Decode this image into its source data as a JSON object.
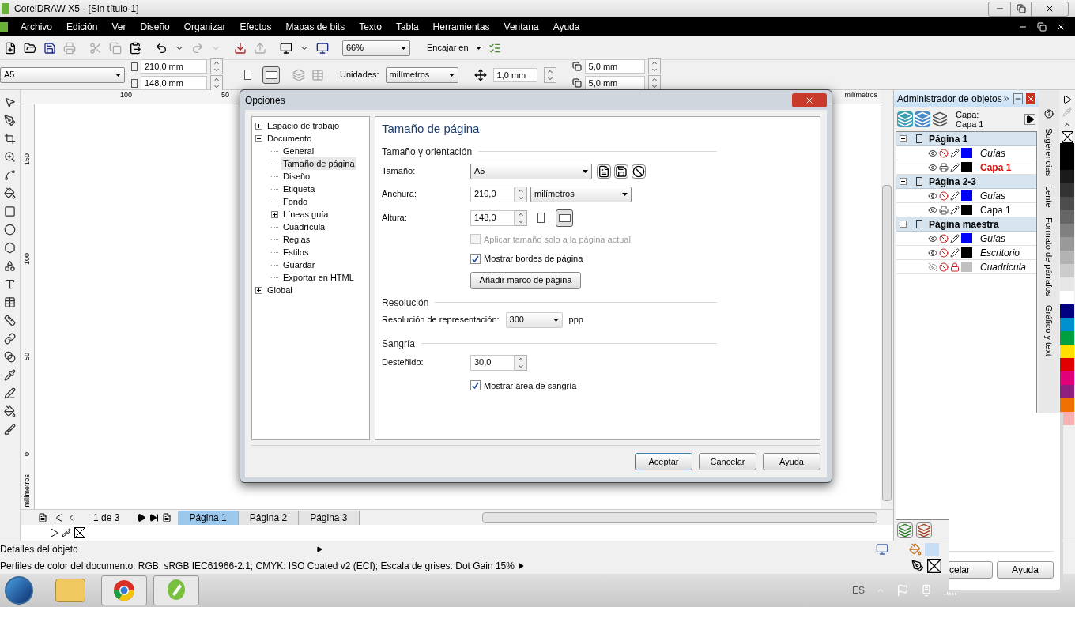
{
  "window": {
    "title": "CorelDRAW X5 - [Sin título-1]"
  },
  "menu": [
    "Archivo",
    "Edición",
    "Ver",
    "Diseño",
    "Organizar",
    "Efectos",
    "Mapas de bits",
    "Texto",
    "Tabla",
    "Herramientas",
    "Ventana",
    "Ayuda"
  ],
  "toolbar": {
    "zoom": "66%",
    "snap": "Encajar en"
  },
  "property_bar": {
    "page_size": "A5",
    "width": "210,0 mm",
    "height": "148,0 mm",
    "orientations": [
      {
        "kind": "portrait",
        "selected": false
      },
      {
        "kind": "landscape",
        "selected": true
      }
    ],
    "units_label": "Unidades:",
    "units": "milímetros",
    "nudge": "1,0 mm",
    "dup_x": "5,0 mm",
    "dup_y": "5,0 mm"
  },
  "ruler": {
    "top_labels": [
      "100",
      "50"
    ],
    "top_unit": "milímetros",
    "left_labels": [
      "150",
      "100",
      "50",
      "0"
    ],
    "left_unit": "milímetros"
  },
  "dialog": {
    "title": "Opciones",
    "tree": [
      {
        "label": "Espacio de trabajo",
        "expanded": false,
        "selected": false
      },
      {
        "label": "Documento",
        "expanded": true,
        "selected": false,
        "children": [
          {
            "label": "General",
            "selected": false
          },
          {
            "label": "Tamaño de página",
            "selected": true
          },
          {
            "label": "Diseño",
            "selected": false
          },
          {
            "label": "Etiqueta",
            "selected": false
          },
          {
            "label": "Fondo",
            "selected": false
          },
          {
            "label": "Líneas guía",
            "expanded": false,
            "selected": false
          },
          {
            "label": "Cuadrícula",
            "selected": false
          },
          {
            "label": "Reglas",
            "selected": false
          },
          {
            "label": "Estilos",
            "selected": false
          },
          {
            "label": "Guardar",
            "selected": false
          },
          {
            "label": "Exportar en HTML",
            "selected": false
          }
        ]
      },
      {
        "label": "Global",
        "expanded": false,
        "selected": false
      }
    ],
    "heading": "Tamaño de página",
    "size_section": "Tamaño y orientación",
    "size_label": "Tamaño:",
    "size_value": "A5",
    "width_label": "Anchura:",
    "width_value": "210,0",
    "unit_value": "milímetros",
    "height_label": "Altura:",
    "height_value": "148,0",
    "orientations": [
      {
        "kind": "portrait",
        "selected": false
      },
      {
        "kind": "landscape",
        "selected": true
      }
    ],
    "checks": [
      {
        "label": "Aplicar tamaño solo a la página actual",
        "checked": false,
        "disabled": true
      },
      {
        "label": "Mostrar bordes de página",
        "checked": true,
        "disabled": false
      }
    ],
    "frame_button": "Añadir marco de página",
    "resolution_section": "Resolución",
    "resolution_label": "Resolución de representación:",
    "resolution_value": "300",
    "resolution_unit": "ppp",
    "bleed_section": "Sangría",
    "bleed_label": "Desteñido:",
    "bleed_value": "30,0",
    "bleed_check": {
      "label": "Mostrar área de sangría",
      "checked": true,
      "disabled": false
    },
    "buttons": [
      "Aceptar",
      "Cancelar",
      "Ayuda"
    ]
  },
  "object_manager": {
    "title": "Administrador de objetos",
    "layer_label": "Capa:",
    "layer_value": "Capa 1",
    "pages": [
      {
        "name": "Página 1",
        "expanded": true,
        "layers": [
          {
            "name": "Guías",
            "kind": "master",
            "color": "#0000ff",
            "visible": true,
            "printable": false,
            "editable": true,
            "active": false
          },
          {
            "name": "Capa 1",
            "kind": "layer",
            "color": "#000000",
            "visible": true,
            "printable": true,
            "editable": true,
            "active": true
          }
        ]
      },
      {
        "name": "Página 2-3",
        "expanded": true,
        "layers": [
          {
            "name": "Guías",
            "kind": "master",
            "color": "#0000ff",
            "visible": true,
            "printable": false,
            "editable": true,
            "active": false
          },
          {
            "name": "Capa 1",
            "kind": "layer",
            "color": "#000000",
            "visible": true,
            "printable": true,
            "editable": true,
            "active": false
          }
        ]
      },
      {
        "name": "Página maestra",
        "expanded": true,
        "layers": [
          {
            "name": "Guías",
            "kind": "master",
            "color": "#0000ff",
            "visible": true,
            "printable": false,
            "editable": true,
            "active": false
          },
          {
            "name": "Escritorio",
            "kind": "master",
            "color": "#000000",
            "visible": true,
            "printable": false,
            "editable": true,
            "active": false
          },
          {
            "name": "Cuadrícula",
            "kind": "master",
            "color": "#c0c0c0",
            "visible": false,
            "printable": false,
            "editable": false,
            "active": false
          }
        ]
      }
    ]
  },
  "docker_tabs": [
    "Sugerencias",
    "Lente",
    "Formato de párrafos",
    "Gráfico y text"
  ],
  "palette": [
    {
      "color": "#000000"
    },
    {
      "color": "#000000"
    },
    {
      "color": "#1a1a1a"
    },
    {
      "color": "#333333"
    },
    {
      "color": "#4d4d4d"
    },
    {
      "color": "#666666"
    },
    {
      "color": "#808080"
    },
    {
      "color": "#999999"
    },
    {
      "color": "#b3b3b3"
    },
    {
      "color": "#cccccc"
    },
    {
      "color": "#e6e6e6"
    },
    {
      "color": "#ffffff"
    },
    {
      "color": "#000080"
    },
    {
      "color": "#0090d0"
    },
    {
      "color": "#00a040"
    },
    {
      "color": "#ffe000"
    },
    {
      "color": "#e00000"
    },
    {
      "color": "#e0007a"
    },
    {
      "color": "#902080"
    },
    {
      "color": "#f07000"
    },
    {
      "color": "#f8b0b0"
    }
  ],
  "page_nav": {
    "counter": "1 de 3",
    "tabs": [
      {
        "label": "Página 1",
        "selected": true
      },
      {
        "label": "Página 2",
        "selected": false
      },
      {
        "label": "Página 3",
        "selected": false
      }
    ]
  },
  "status": {
    "details": "Detalles del objeto",
    "profiles": "Perfiles de color del documento: RGB: sRGB IEC61966-2.1; CMYK: ISO Coated v2 (ECI); Escala de grises: Dot Gain 15%",
    "fill_swatch": {
      "color": "#c8def4"
    }
  },
  "back_dialog": {
    "buttons": [
      "celar",
      "Ayuda"
    ]
  },
  "taskbar": {
    "language": "ES"
  }
}
